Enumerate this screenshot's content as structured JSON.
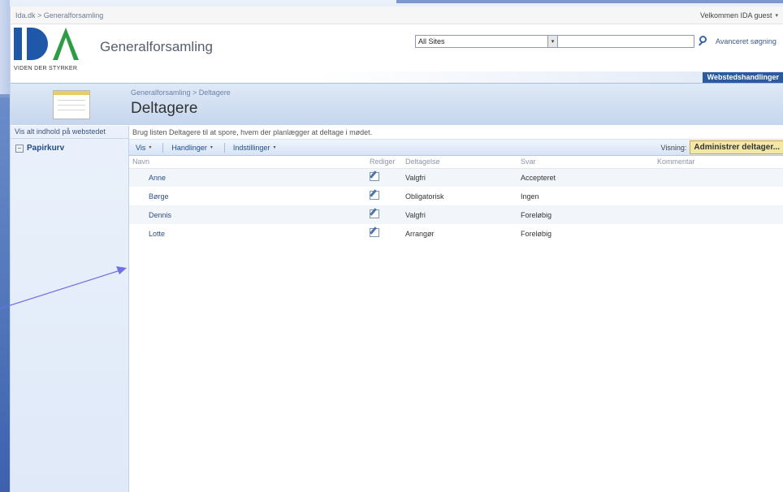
{
  "topbar": {
    "breadcrumb": "Ida.dk > Generalforsamling",
    "welcome": "Velkommen IDA guest",
    "welcome_caret": "▾"
  },
  "header": {
    "logo_tagline": "VIDEN DER STYRKER",
    "site_title": "Generalforsamling",
    "search_scope": "All Sites",
    "search_scope_arrow": "▾",
    "search_query": "",
    "advanced_search": "Avanceret søgning",
    "site_actions": "Webstedshandlinger"
  },
  "page": {
    "breadcrumb": "Generalforsamling > Deltagere",
    "title": "Deltagere",
    "description": "Brug listen Deltagere til at spore, hvem der planlægger at deltage i mødet."
  },
  "leftnav": {
    "view_all": "Vis alt indhold på webstedet",
    "recycle_bin": "Papirkurv"
  },
  "toolbar": {
    "menus": [
      {
        "label": "Vis",
        "caret": "▾"
      },
      {
        "label": "Handlinger",
        "caret": "▾"
      },
      {
        "label": "Indstillinger",
        "caret": "▾"
      }
    ],
    "view_label": "Visning:",
    "admin_button": "Administrer deltager..."
  },
  "table": {
    "headers": [
      "Navn",
      "Rediger",
      "Deltagelse",
      "Svar",
      "Kommentar"
    ],
    "rows": [
      {
        "name": "Anne",
        "attendance": "Valgfri",
        "response": "Accepteret",
        "comment": ""
      },
      {
        "name": "Børge",
        "attendance": "Obligatorisk",
        "response": "Ingen",
        "comment": ""
      },
      {
        "name": "Dennis",
        "attendance": "Valgfri",
        "response": "Foreløbig",
        "comment": ""
      },
      {
        "name": "Lotte",
        "attendance": "Arrangør",
        "response": "Foreløbig",
        "comment": ""
      }
    ]
  },
  "colors": {
    "accent": "#2d5a9e",
    "arrow": "#6f6fe6",
    "admin_button_bg": "#f5e7a8"
  }
}
